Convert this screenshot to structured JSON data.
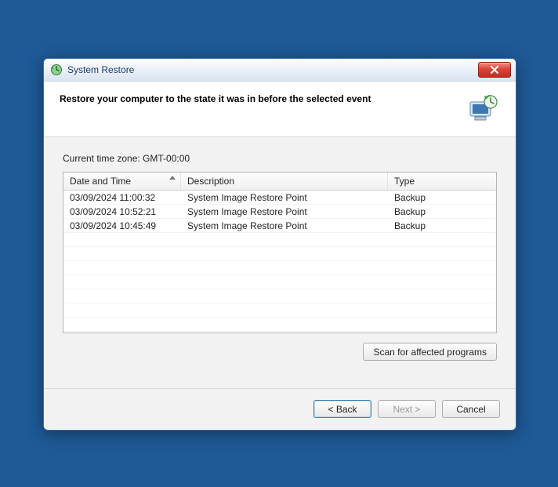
{
  "window": {
    "title": "System Restore"
  },
  "header": {
    "heading": "Restore your computer to the state it was in before the selected event"
  },
  "body": {
    "timezone_line": "Current time zone: GMT-00:00",
    "columns": {
      "datetime": "Date and Time",
      "description": "Description",
      "type": "Type"
    },
    "rows": [
      {
        "datetime": "03/09/2024 11:00:32",
        "description": "System Image Restore Point",
        "type": "Backup"
      },
      {
        "datetime": "03/09/2024 10:52:21",
        "description": "System Image Restore Point",
        "type": "Backup"
      },
      {
        "datetime": "03/09/2024 10:45:49",
        "description": "System Image Restore Point",
        "type": "Backup"
      }
    ]
  },
  "buttons": {
    "scan": "Scan for affected programs",
    "back": "< Back",
    "next": "Next >",
    "cancel": "Cancel"
  }
}
